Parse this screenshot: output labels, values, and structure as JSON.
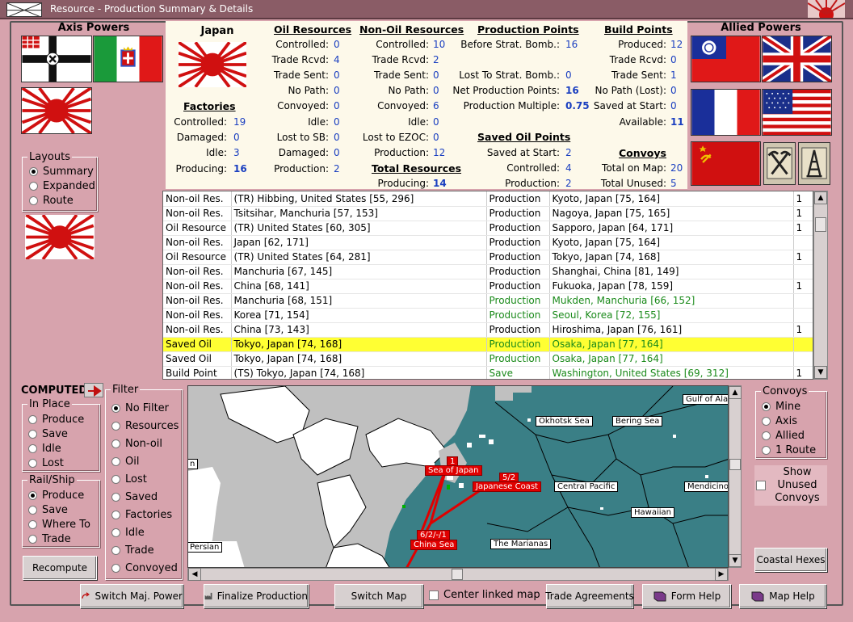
{
  "window": {
    "title": "Resource - Production Summary & Details"
  },
  "colors": {
    "panel_bg": "#d7a3ad",
    "summary_bg": "#fdf9ea",
    "value_blue": "#1a3fc0",
    "highlight": "#ffff33",
    "route_red": "#e00000",
    "sea": "#3a7f86"
  },
  "axis": {
    "title": "Axis Powers"
  },
  "allied": {
    "title": "Allied Powers"
  },
  "layouts": {
    "legend": "Layouts",
    "options": [
      "Summary",
      "Expanded",
      "Route"
    ],
    "selected": "Summary"
  },
  "summary": {
    "nation": "Japan",
    "factories": {
      "title": "Factories",
      "rows": [
        {
          "label": "Controlled:",
          "value": "19"
        },
        {
          "label": "Damaged:",
          "value": "0"
        },
        {
          "label": "Idle:",
          "value": "3"
        },
        {
          "label": "Producing:",
          "value": "16"
        }
      ]
    },
    "oil": {
      "title": "Oil Resources",
      "rows": [
        {
          "label": "Controlled:",
          "value": "0"
        },
        {
          "label": "Trade Rcvd:",
          "value": "4"
        },
        {
          "label": "Trade Sent:",
          "value": "0"
        },
        {
          "label": "No Path:",
          "value": "0"
        },
        {
          "label": "Convoyed:",
          "value": "0"
        },
        {
          "label": "Idle:",
          "value": "0"
        },
        {
          "label": "Lost to SB:",
          "value": "0"
        },
        {
          "label": "Damaged:",
          "value": "0"
        },
        {
          "label": "Production:",
          "value": "2"
        }
      ]
    },
    "nonoil": {
      "title": "Non-Oil Resources",
      "rows": [
        {
          "label": "Controlled:",
          "value": "10"
        },
        {
          "label": "Trade Rcvd:",
          "value": "2"
        },
        {
          "label": "Trade Sent:",
          "value": "0"
        },
        {
          "label": "No Path:",
          "value": "0"
        },
        {
          "label": "Convoyed:",
          "value": "6"
        },
        {
          "label": "Idle:",
          "value": "0"
        },
        {
          "label": "Lost to EZOC:",
          "value": "0"
        },
        {
          "label": "Production:",
          "value": "12"
        }
      ]
    },
    "total": {
      "title": "Total Resources",
      "label": "Producing:",
      "value": "14"
    },
    "pp": {
      "title": "Production Points",
      "rows": [
        {
          "label": "Before Strat. Bomb.:",
          "value": "16"
        },
        {
          "label": "Lost To Strat. Bomb.:",
          "value": "0"
        },
        {
          "label": "Net Production Points:",
          "value": "16"
        },
        {
          "label": "Production Multiple:",
          "value": "0.75"
        }
      ]
    },
    "savedoil": {
      "title": "Saved Oil Points",
      "rows": [
        {
          "label": "Saved at Start:",
          "value": "2"
        },
        {
          "label": "Controlled:",
          "value": "4"
        },
        {
          "label": "Production:",
          "value": "2"
        }
      ]
    },
    "bp": {
      "title": "Build Points",
      "rows": [
        {
          "label": "Produced:",
          "value": "12"
        },
        {
          "label": "Trade Rcvd:",
          "value": "0"
        },
        {
          "label": "Trade Sent:",
          "value": "1"
        },
        {
          "label": "No Path (Lost):",
          "value": "0"
        },
        {
          "label": "Saved at Start:",
          "value": "0"
        },
        {
          "label": "Available:",
          "value": "11"
        }
      ]
    },
    "convoys": {
      "title": "Convoys",
      "rows": [
        {
          "label": "Total on Map:",
          "value": "20"
        },
        {
          "label": "Total Unused:",
          "value": "5"
        }
      ]
    }
  },
  "table": {
    "rows": [
      {
        "type": "Non-oil Res.",
        "source": "(TR) Hibbing, United States [55, 296]",
        "use": "Production",
        "dest": "Kyoto, Japan [75, 164]",
        "n": "1",
        "green": false,
        "sel": false
      },
      {
        "type": "Non-oil Res.",
        "source": "Tsitsihar, Manchuria [57, 153]",
        "use": "Production",
        "dest": "Nagoya, Japan [75, 165]",
        "n": "1",
        "green": false,
        "sel": false
      },
      {
        "type": "Oil Resource",
        "source": "(TR) United States [60, 305]",
        "use": "Production",
        "dest": "Sapporo, Japan [64, 171]",
        "n": "1",
        "green": false,
        "sel": false
      },
      {
        "type": "Non-oil Res.",
        "source": "Japan [62, 171]",
        "use": "Production",
        "dest": "Kyoto, Japan [75, 164]",
        "n": "",
        "green": false,
        "sel": false
      },
      {
        "type": "Oil Resource",
        "source": "(TR) United States [64, 281]",
        "use": "Production",
        "dest": "Tokyo, Japan [74, 168]",
        "n": "1",
        "green": false,
        "sel": false
      },
      {
        "type": "Non-oil Res.",
        "source": "Manchuria [67, 145]",
        "use": "Production",
        "dest": "Shanghai, China [81, 149]",
        "n": "",
        "green": false,
        "sel": false
      },
      {
        "type": "Non-oil Res.",
        "source": "China [68, 141]",
        "use": "Production",
        "dest": "Fukuoka, Japan [78, 159]",
        "n": "1",
        "green": false,
        "sel": false
      },
      {
        "type": "Non-oil Res.",
        "source": "Manchuria [68, 151]",
        "use": "Production",
        "dest": "Mukden, Manchuria [66, 152]",
        "n": "",
        "green": true,
        "sel": false
      },
      {
        "type": "Non-oil Res.",
        "source": "Korea [71, 154]",
        "use": "Production",
        "dest": "Seoul, Korea [72, 155]",
        "n": "",
        "green": true,
        "sel": false
      },
      {
        "type": "Non-oil Res.",
        "source": "China [73, 143]",
        "use": "Production",
        "dest": "Hiroshima, Japan [76, 161]",
        "n": "1",
        "green": false,
        "sel": false
      },
      {
        "type": "Saved Oil",
        "source": "Tokyo, Japan [74, 168]",
        "use": "Production",
        "dest": "Osaka, Japan [77, 164]",
        "n": "",
        "green": true,
        "sel": true
      },
      {
        "type": "Saved Oil",
        "source": "Tokyo, Japan [74, 168]",
        "use": "Production",
        "dest": "Osaka, Japan [77, 164]",
        "n": "",
        "green": true,
        "sel": false
      },
      {
        "type": "Build Point",
        "source": "(TS) Tokyo, Japan [74, 168]",
        "use": "Save",
        "dest": "Washington, United States [69, 312]",
        "n": "1",
        "green": true,
        "sel": false
      }
    ]
  },
  "computed": {
    "label": "COMPUTED"
  },
  "inplace": {
    "legend": "In Place",
    "options": [
      "Produce",
      "Save",
      "Idle",
      "Lost"
    ],
    "selected": ""
  },
  "railship": {
    "legend": "Rail/Ship",
    "options": [
      "Produce",
      "Save",
      "Where To",
      "Trade"
    ],
    "selected": "Produce"
  },
  "filter": {
    "legend": "Filter",
    "options": [
      "No Filter",
      "Resources",
      "Non-oil",
      "Oil",
      "Lost",
      "Saved",
      "Factories",
      "Idle",
      "Trade",
      "Convoyed"
    ],
    "selected": "No Filter"
  },
  "convoys_filter": {
    "legend": "Convoys",
    "options": [
      "Mine",
      "Axis",
      "Allied",
      "1 Route"
    ],
    "selected": "Mine"
  },
  "show_unused": {
    "label": "Show Unused Convoys"
  },
  "map": {
    "sea_labels": [
      "Gulf of Alaska",
      "Okhotsk Sea",
      "Bering Sea",
      "Central Pacific",
      "Mendicino",
      "Hawaiian",
      "The Marianas",
      "Persian",
      "n"
    ],
    "route_labels": [
      "1",
      "Sea of Japan",
      "5/2",
      "Japanese Coast",
      "6/2/-/1",
      "China Sea"
    ]
  },
  "buttons": {
    "recompute": "Recompute",
    "coastal": "Coastal Hexes",
    "switch_power": "Switch Maj. Power",
    "finalize": "Finalize Production",
    "switch_map": "Switch Map",
    "center_linked": "Center linked map",
    "trade": "Trade Agreements",
    "form_help": "Form Help",
    "map_help": "Map Help"
  }
}
